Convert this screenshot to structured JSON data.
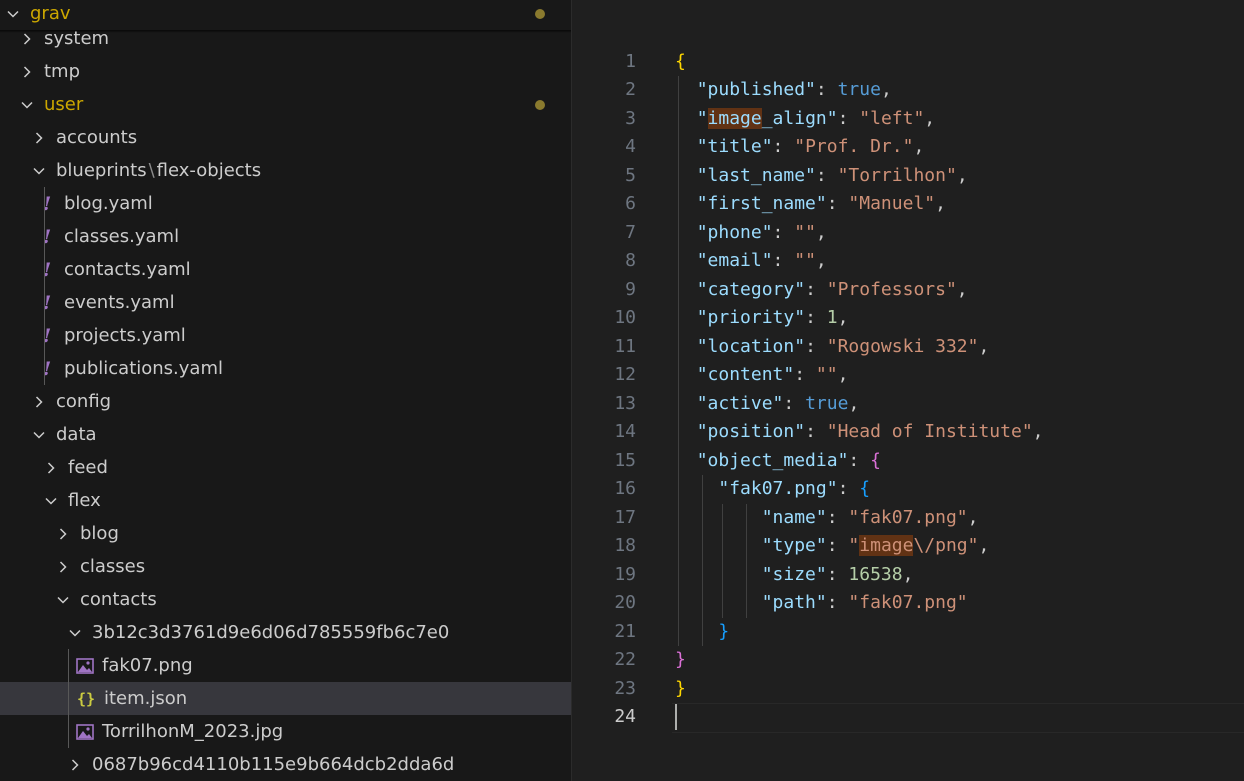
{
  "explorer": {
    "root": "grav",
    "items": [
      {
        "label": "system",
        "kind": "folder",
        "open": false,
        "depth": 1
      },
      {
        "label": "tmp",
        "kind": "folder",
        "open": false,
        "depth": 1
      },
      {
        "label": "user",
        "kind": "folder",
        "open": true,
        "depth": 1,
        "modified": true
      },
      {
        "label": "accounts",
        "kind": "folder",
        "open": false,
        "depth": 2
      },
      {
        "label": "blueprints",
        "label2": "flex-objects",
        "kind": "folder",
        "open": true,
        "depth": 2
      },
      {
        "label": "blog.yaml",
        "kind": "yaml",
        "depth": 3
      },
      {
        "label": "classes.yaml",
        "kind": "yaml",
        "depth": 3
      },
      {
        "label": "contacts.yaml",
        "kind": "yaml",
        "depth": 3
      },
      {
        "label": "events.yaml",
        "kind": "yaml",
        "depth": 3
      },
      {
        "label": "projects.yaml",
        "kind": "yaml",
        "depth": 3
      },
      {
        "label": "publications.yaml",
        "kind": "yaml",
        "depth": 3
      },
      {
        "label": "config",
        "kind": "folder",
        "open": false,
        "depth": 2
      },
      {
        "label": "data",
        "kind": "folder",
        "open": true,
        "depth": 2
      },
      {
        "label": "feed",
        "kind": "folder",
        "open": false,
        "depth": 3
      },
      {
        "label": "flex",
        "kind": "folder",
        "open": true,
        "depth": 3
      },
      {
        "label": "blog",
        "kind": "folder",
        "open": false,
        "depth": 4
      },
      {
        "label": "classes",
        "kind": "folder",
        "open": false,
        "depth": 4
      },
      {
        "label": "contacts",
        "kind": "folder",
        "open": true,
        "depth": 4
      },
      {
        "label": "3b12c3d3761d9e6d06d785559fb6c7e0",
        "kind": "folder",
        "open": true,
        "depth": 5
      },
      {
        "label": "fak07.png",
        "kind": "image",
        "depth": 6
      },
      {
        "label": "item.json",
        "kind": "json",
        "depth": 6,
        "selected": true
      },
      {
        "label": "TorrilhonM_2023.jpg",
        "kind": "image",
        "depth": 6
      },
      {
        "label": "0687b96cd4110b115e9b664dcb2dda6d",
        "kind": "folder",
        "open": false,
        "depth": 5
      }
    ]
  },
  "editor": {
    "active_line": 24,
    "lines": [
      [
        [
          "b1",
          "{"
        ]
      ],
      [
        [
          "p",
          "  "
        ],
        [
          "key",
          "\"published\""
        ],
        [
          "p",
          ": "
        ],
        [
          "kw",
          "true"
        ],
        [
          "p",
          ","
        ]
      ],
      [
        [
          "p",
          "  "
        ],
        [
          "key",
          "\""
        ],
        [
          "keyhl",
          "image"
        ],
        [
          "key",
          "_align\""
        ],
        [
          "p",
          ": "
        ],
        [
          "str",
          "\"left\""
        ],
        [
          "p",
          ","
        ]
      ],
      [
        [
          "p",
          "  "
        ],
        [
          "key",
          "\"title\""
        ],
        [
          "p",
          ": "
        ],
        [
          "str",
          "\"Prof. Dr.\""
        ],
        [
          "p",
          ","
        ]
      ],
      [
        [
          "p",
          "  "
        ],
        [
          "key",
          "\"last_name\""
        ],
        [
          "p",
          ": "
        ],
        [
          "str",
          "\"Torrilhon\""
        ],
        [
          "p",
          ","
        ]
      ],
      [
        [
          "p",
          "  "
        ],
        [
          "key",
          "\"first_name\""
        ],
        [
          "p",
          ": "
        ],
        [
          "str",
          "\"Manuel\""
        ],
        [
          "p",
          ","
        ]
      ],
      [
        [
          "p",
          "  "
        ],
        [
          "key",
          "\"phone\""
        ],
        [
          "p",
          ": "
        ],
        [
          "str",
          "\"\""
        ],
        [
          "p",
          ","
        ]
      ],
      [
        [
          "p",
          "  "
        ],
        [
          "key",
          "\"email\""
        ],
        [
          "p",
          ": "
        ],
        [
          "str",
          "\"\""
        ],
        [
          "p",
          ","
        ]
      ],
      [
        [
          "p",
          "  "
        ],
        [
          "key",
          "\"category\""
        ],
        [
          "p",
          ": "
        ],
        [
          "str",
          "\"Professors\""
        ],
        [
          "p",
          ","
        ]
      ],
      [
        [
          "p",
          "  "
        ],
        [
          "key",
          "\"priority\""
        ],
        [
          "p",
          ": "
        ],
        [
          "num",
          "1"
        ],
        [
          "p",
          ","
        ]
      ],
      [
        [
          "p",
          "  "
        ],
        [
          "key",
          "\"location\""
        ],
        [
          "p",
          ": "
        ],
        [
          "str",
          "\"Rogowski 332\""
        ],
        [
          "p",
          ","
        ]
      ],
      [
        [
          "p",
          "  "
        ],
        [
          "key",
          "\"content\""
        ],
        [
          "p",
          ": "
        ],
        [
          "str",
          "\"\""
        ],
        [
          "p",
          ","
        ]
      ],
      [
        [
          "p",
          "  "
        ],
        [
          "key",
          "\"active\""
        ],
        [
          "p",
          ": "
        ],
        [
          "kw",
          "true"
        ],
        [
          "p",
          ","
        ]
      ],
      [
        [
          "p",
          "  "
        ],
        [
          "key",
          "\"position\""
        ],
        [
          "p",
          ": "
        ],
        [
          "str",
          "\"Head of Institute\""
        ],
        [
          "p",
          ","
        ]
      ],
      [
        [
          "p",
          "  "
        ],
        [
          "key",
          "\"object_media\""
        ],
        [
          "p",
          ": "
        ],
        [
          "b2",
          "{"
        ]
      ],
      [
        [
          "p",
          "    "
        ],
        [
          "key",
          "\"fak07.png\""
        ],
        [
          "p",
          ": "
        ],
        [
          "b3",
          "{"
        ]
      ],
      [
        [
          "p",
          "        "
        ],
        [
          "key",
          "\"name\""
        ],
        [
          "p",
          ": "
        ],
        [
          "str",
          "\"fak07.png\""
        ],
        [
          "p",
          ","
        ]
      ],
      [
        [
          "p",
          "        "
        ],
        [
          "key",
          "\"type\""
        ],
        [
          "p",
          ": "
        ],
        [
          "str",
          "\""
        ],
        [
          "strhl",
          "image"
        ],
        [
          "str",
          "\\/png\""
        ],
        [
          "p",
          ","
        ]
      ],
      [
        [
          "p",
          "        "
        ],
        [
          "key",
          "\"size\""
        ],
        [
          "p",
          ": "
        ],
        [
          "num",
          "16538"
        ],
        [
          "p",
          ","
        ]
      ],
      [
        [
          "p",
          "        "
        ],
        [
          "key",
          "\"path\""
        ],
        [
          "p",
          ": "
        ],
        [
          "str",
          "\"fak07.png\""
        ]
      ],
      [
        [
          "p",
          "    "
        ],
        [
          "b3",
          "}"
        ]
      ],
      [
        [
          "b2",
          "}"
        ]
      ],
      [
        [
          "b1",
          "}"
        ]
      ],
      []
    ]
  }
}
